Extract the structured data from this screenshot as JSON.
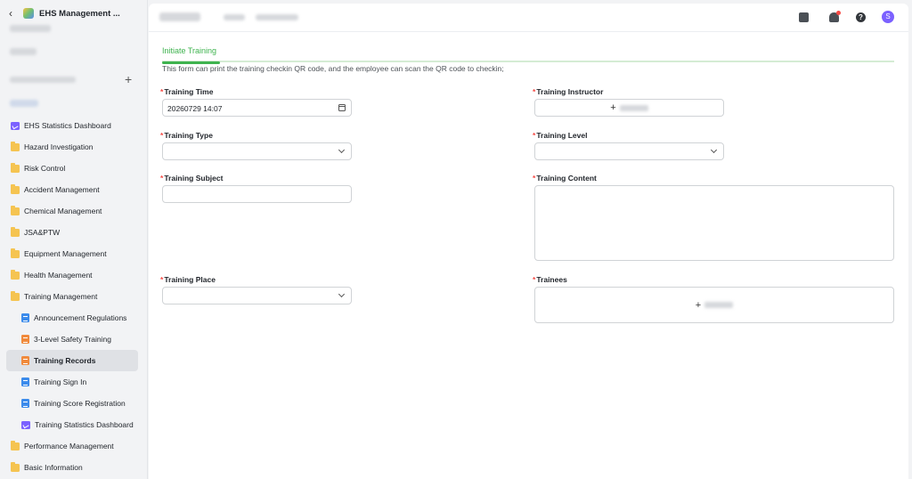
{
  "app": {
    "title": "EHS Management ..."
  },
  "sidebar": {
    "items": [
      {
        "label": "EHS Statistics Dashboard",
        "icon": "dashboard-icon",
        "level": 0,
        "active": false
      },
      {
        "label": "Hazard Investigation",
        "icon": "folder-icon",
        "level": 0,
        "active": false
      },
      {
        "label": "Risk Control",
        "icon": "folder-icon",
        "level": 0,
        "active": false
      },
      {
        "label": "Accident Management",
        "icon": "folder-icon",
        "level": 0,
        "active": false
      },
      {
        "label": "Chemical Management",
        "icon": "folder-icon",
        "level": 0,
        "active": false
      },
      {
        "label": "JSA&PTW",
        "icon": "folder-icon",
        "level": 0,
        "active": false
      },
      {
        "label": "Equipment Management",
        "icon": "folder-icon",
        "level": 0,
        "active": false
      },
      {
        "label": "Health Management",
        "icon": "folder-icon",
        "level": 0,
        "active": false
      },
      {
        "label": "Training Management",
        "icon": "folder-icon",
        "level": 0,
        "active": false
      },
      {
        "label": "Announcement Regulations",
        "icon": "document-icon",
        "level": 1,
        "active": false
      },
      {
        "label": "3-Level Safety Training",
        "icon": "form-icon",
        "level": 1,
        "active": false
      },
      {
        "label": "Training Records",
        "icon": "form-icon",
        "level": 1,
        "active": true
      },
      {
        "label": "Training Sign In",
        "icon": "document-icon",
        "level": 1,
        "active": false
      },
      {
        "label": "Training Score Registration",
        "icon": "document-icon",
        "level": 1,
        "active": false
      },
      {
        "label": "Training Statistics Dashboard",
        "icon": "dashboard-icon",
        "level": 1,
        "active": false
      },
      {
        "label": "Performance Management",
        "icon": "folder-icon",
        "level": 0,
        "active": false
      },
      {
        "label": "Basic Information",
        "icon": "folder-icon",
        "level": 0,
        "active": false
      }
    ]
  },
  "topbar": {
    "avatar_letter": "S",
    "help_symbol": "?"
  },
  "tabs": {
    "active": "Initiate Training"
  },
  "form": {
    "description": "This form can print the training checkin QR code, and the employee can scan the QR code to checkin;",
    "required_mark": "*",
    "training_time": {
      "label": "Training Time",
      "value": "20260729 14:07"
    },
    "training_instructor": {
      "label": "Training Instructor",
      "add_symbol": "+"
    },
    "training_type": {
      "label": "Training Type",
      "value": ""
    },
    "training_level": {
      "label": "Training Level",
      "value": ""
    },
    "training_subject": {
      "label": "Training Subject",
      "value": ""
    },
    "training_content": {
      "label": "Training Content",
      "value": ""
    },
    "training_place": {
      "label": "Training Place",
      "value": ""
    },
    "trainees": {
      "label": "Trainees",
      "add_symbol": "+"
    }
  },
  "colors": {
    "accent_green": "#3fb34f",
    "required_red": "#f54a45",
    "folder_yellow": "#f5c451",
    "dashboard_purple": "#7b61ff",
    "doc_blue": "#3b8beb",
    "form_orange": "#f08a3c"
  }
}
